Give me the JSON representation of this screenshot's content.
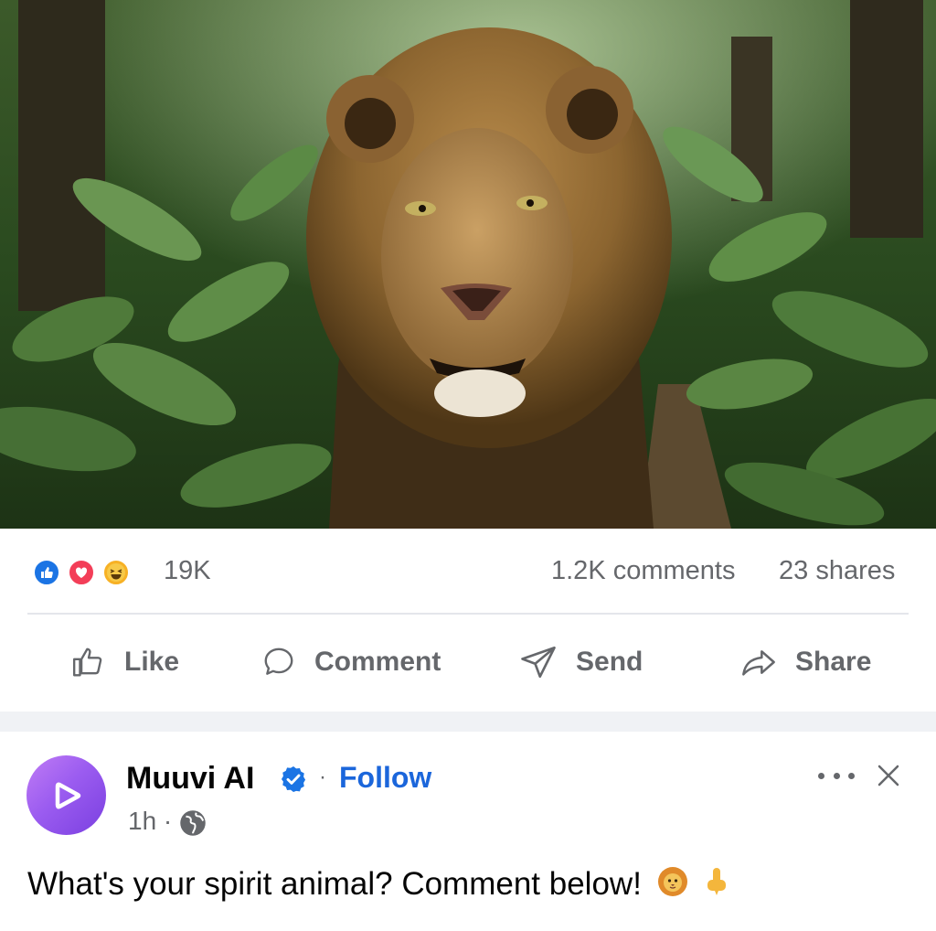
{
  "reactions": {
    "icons": [
      "like-icon",
      "love-icon",
      "haha-icon"
    ],
    "count": "19K",
    "comments": "1.2K comments",
    "shares": "23 shares"
  },
  "actions": {
    "like": "Like",
    "comment": "Comment",
    "send": "Send",
    "share": "Share"
  },
  "post": {
    "author": "Muuvi AI",
    "follow": "Follow",
    "time": "1h",
    "caption": "What's your spirit animal? Comment below!",
    "caption_emojis": [
      "lion-face-emoji",
      "pointing-down-emoji"
    ]
  },
  "colors": {
    "accent": "#1b66db",
    "muted": "#65676b",
    "like": "#1b74e4",
    "love": "#f33e58",
    "haha": "#f7b125"
  }
}
